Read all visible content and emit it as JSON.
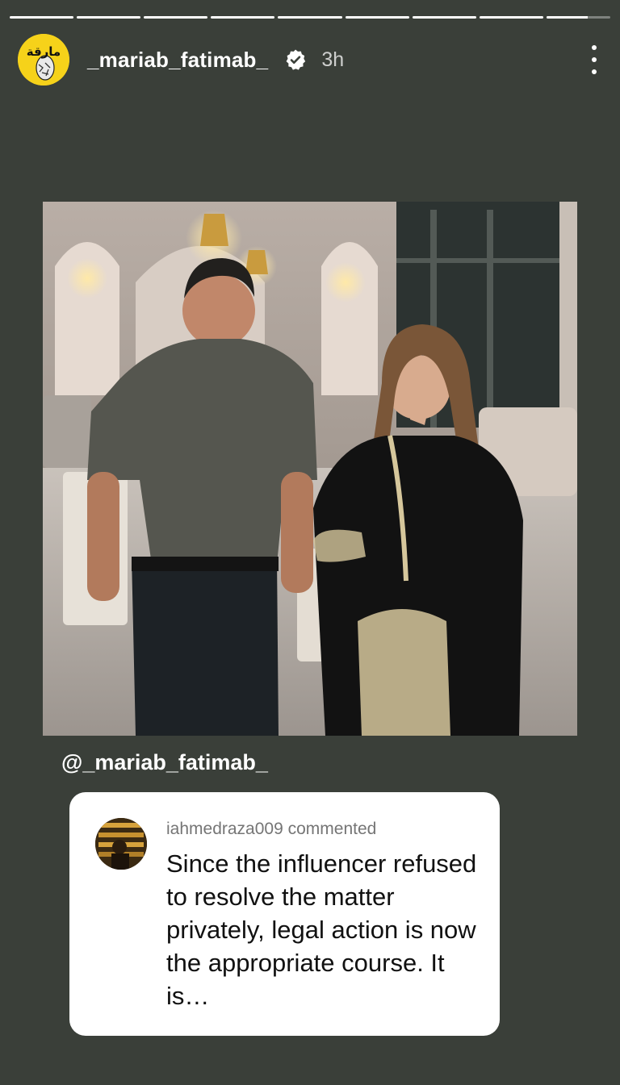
{
  "progress": {
    "segments": 9,
    "completed": 8,
    "current_fill": 0.65
  },
  "header": {
    "username": "_mariab_fatimab_",
    "time": "3h",
    "avatar_text": "مارقة",
    "verified_icon": "verified-badge-icon",
    "more_icon": "more-vertical-icon"
  },
  "mention": "@_mariab_fatimab_",
  "comment": {
    "user_line": "iahmedraza009 commented",
    "text": "Since the influencer refused to resolve the matter privately, legal action is now the appropriate course. It is…"
  },
  "colors": {
    "background": "#3a3f39",
    "avatar_bg": "#f6d21a",
    "card_bg": "#ffffff"
  }
}
